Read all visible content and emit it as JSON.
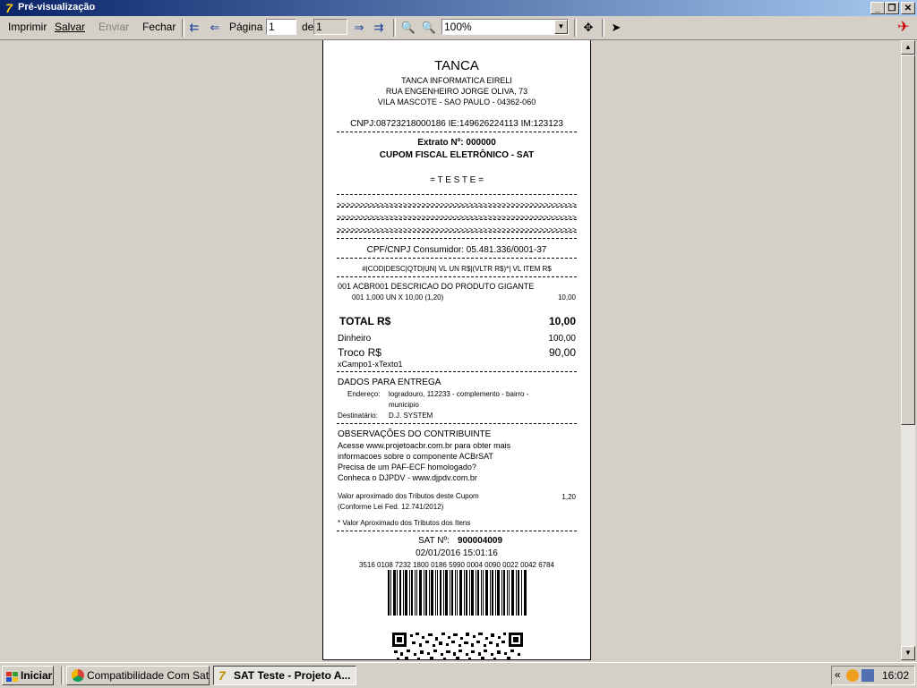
{
  "window": {
    "title": "Pré-visualização"
  },
  "toolbar": {
    "print": "Imprimir",
    "save": "Salvar",
    "send": "Enviar",
    "close": "Fechar",
    "page_label": "Página",
    "page_value": "1",
    "of_label": "de",
    "total_pages": "1",
    "zoom": "100%"
  },
  "receipt": {
    "company_name": "TANCA",
    "legal_name": "TANCA INFORMATICA EIRELI",
    "address1": "RUA ENGENHEIRO JORGE OLIVA, 73",
    "address2": "VILA MASCOTE - SAO PAULO - 04362-060",
    "ids": "CNPJ:08723218000186 IE:149626224113 IM:123123",
    "extrato": "Extrato Nº: 000000",
    "cupom": "CUPOM FISCAL ELETRÔNICO - SAT",
    "teste": "= T E S T E =",
    "arrows": ">>>>>>>>>>>>>>>>>>>>>>>>>>>>>>>>>>>>>>>>>>>>>>>>>>>",
    "consumer": "CPF/CNPJ Consumidor: 05.481.336/0001-37",
    "item_header": "#|COD|DESC|QTD|UN| VL UN R$|(VLTR R$)*| VL ITEM R$",
    "item_line1": "001 ACBR001 DESCRICAO DO PRODUTO GIGANTE",
    "item_line2": "001 1,000 UN X 10,00 (1,20)",
    "item_value": "10,00",
    "total_label": "TOTAL R$",
    "total_value": "10,00",
    "cash_label": "Dinheiro",
    "cash_value": "100,00",
    "change_label": "Troco R$",
    "change_value": "90,00",
    "extra_field": "xCampo1-xTexto1",
    "delivery_title": "DADOS PARA ENTREGA",
    "address_label": "Endereço:",
    "address_value1": "logradouro, 112233 - complemento - bairro -",
    "address_value2": "municipio",
    "recipient_label": "Destinatário:",
    "recipient_value": "D.J. SYSTEM",
    "obs_title": "OBSERVAÇÕES DO CONTRIBUINTE",
    "obs1": "Acesse www.projetoacbr.com.br para obter mais",
    "obs2": "informacoes sobre o componente ACBrSAT",
    "obs3": "Precisa de um PAF-ECF homologado?",
    "obs4": "Conheca o DJPDV - www.djpdv.com.br",
    "tax_line1": "Valor aproximado dos Tributos deste Cupom",
    "tax_line2": "(Conforme Lei Fed. 12.741/2012)",
    "tax_value": "1,20",
    "tax_note": "* Valor Aproximado dos Tributos dos Itens",
    "sat_label": "SAT Nº:",
    "sat_number": "900004009",
    "datetime": "02/01/2016 15:01:16",
    "access_key": "3516 0108 7232 1800 0186 5990 0004 0090 0022 0042 6784"
  },
  "taskbar": {
    "start": "Iniciar",
    "task1": "Compatibilidade Com Sat...",
    "task2": "SAT Teste - Projeto A...",
    "tray_chevron": "«",
    "clock": "16:02"
  }
}
